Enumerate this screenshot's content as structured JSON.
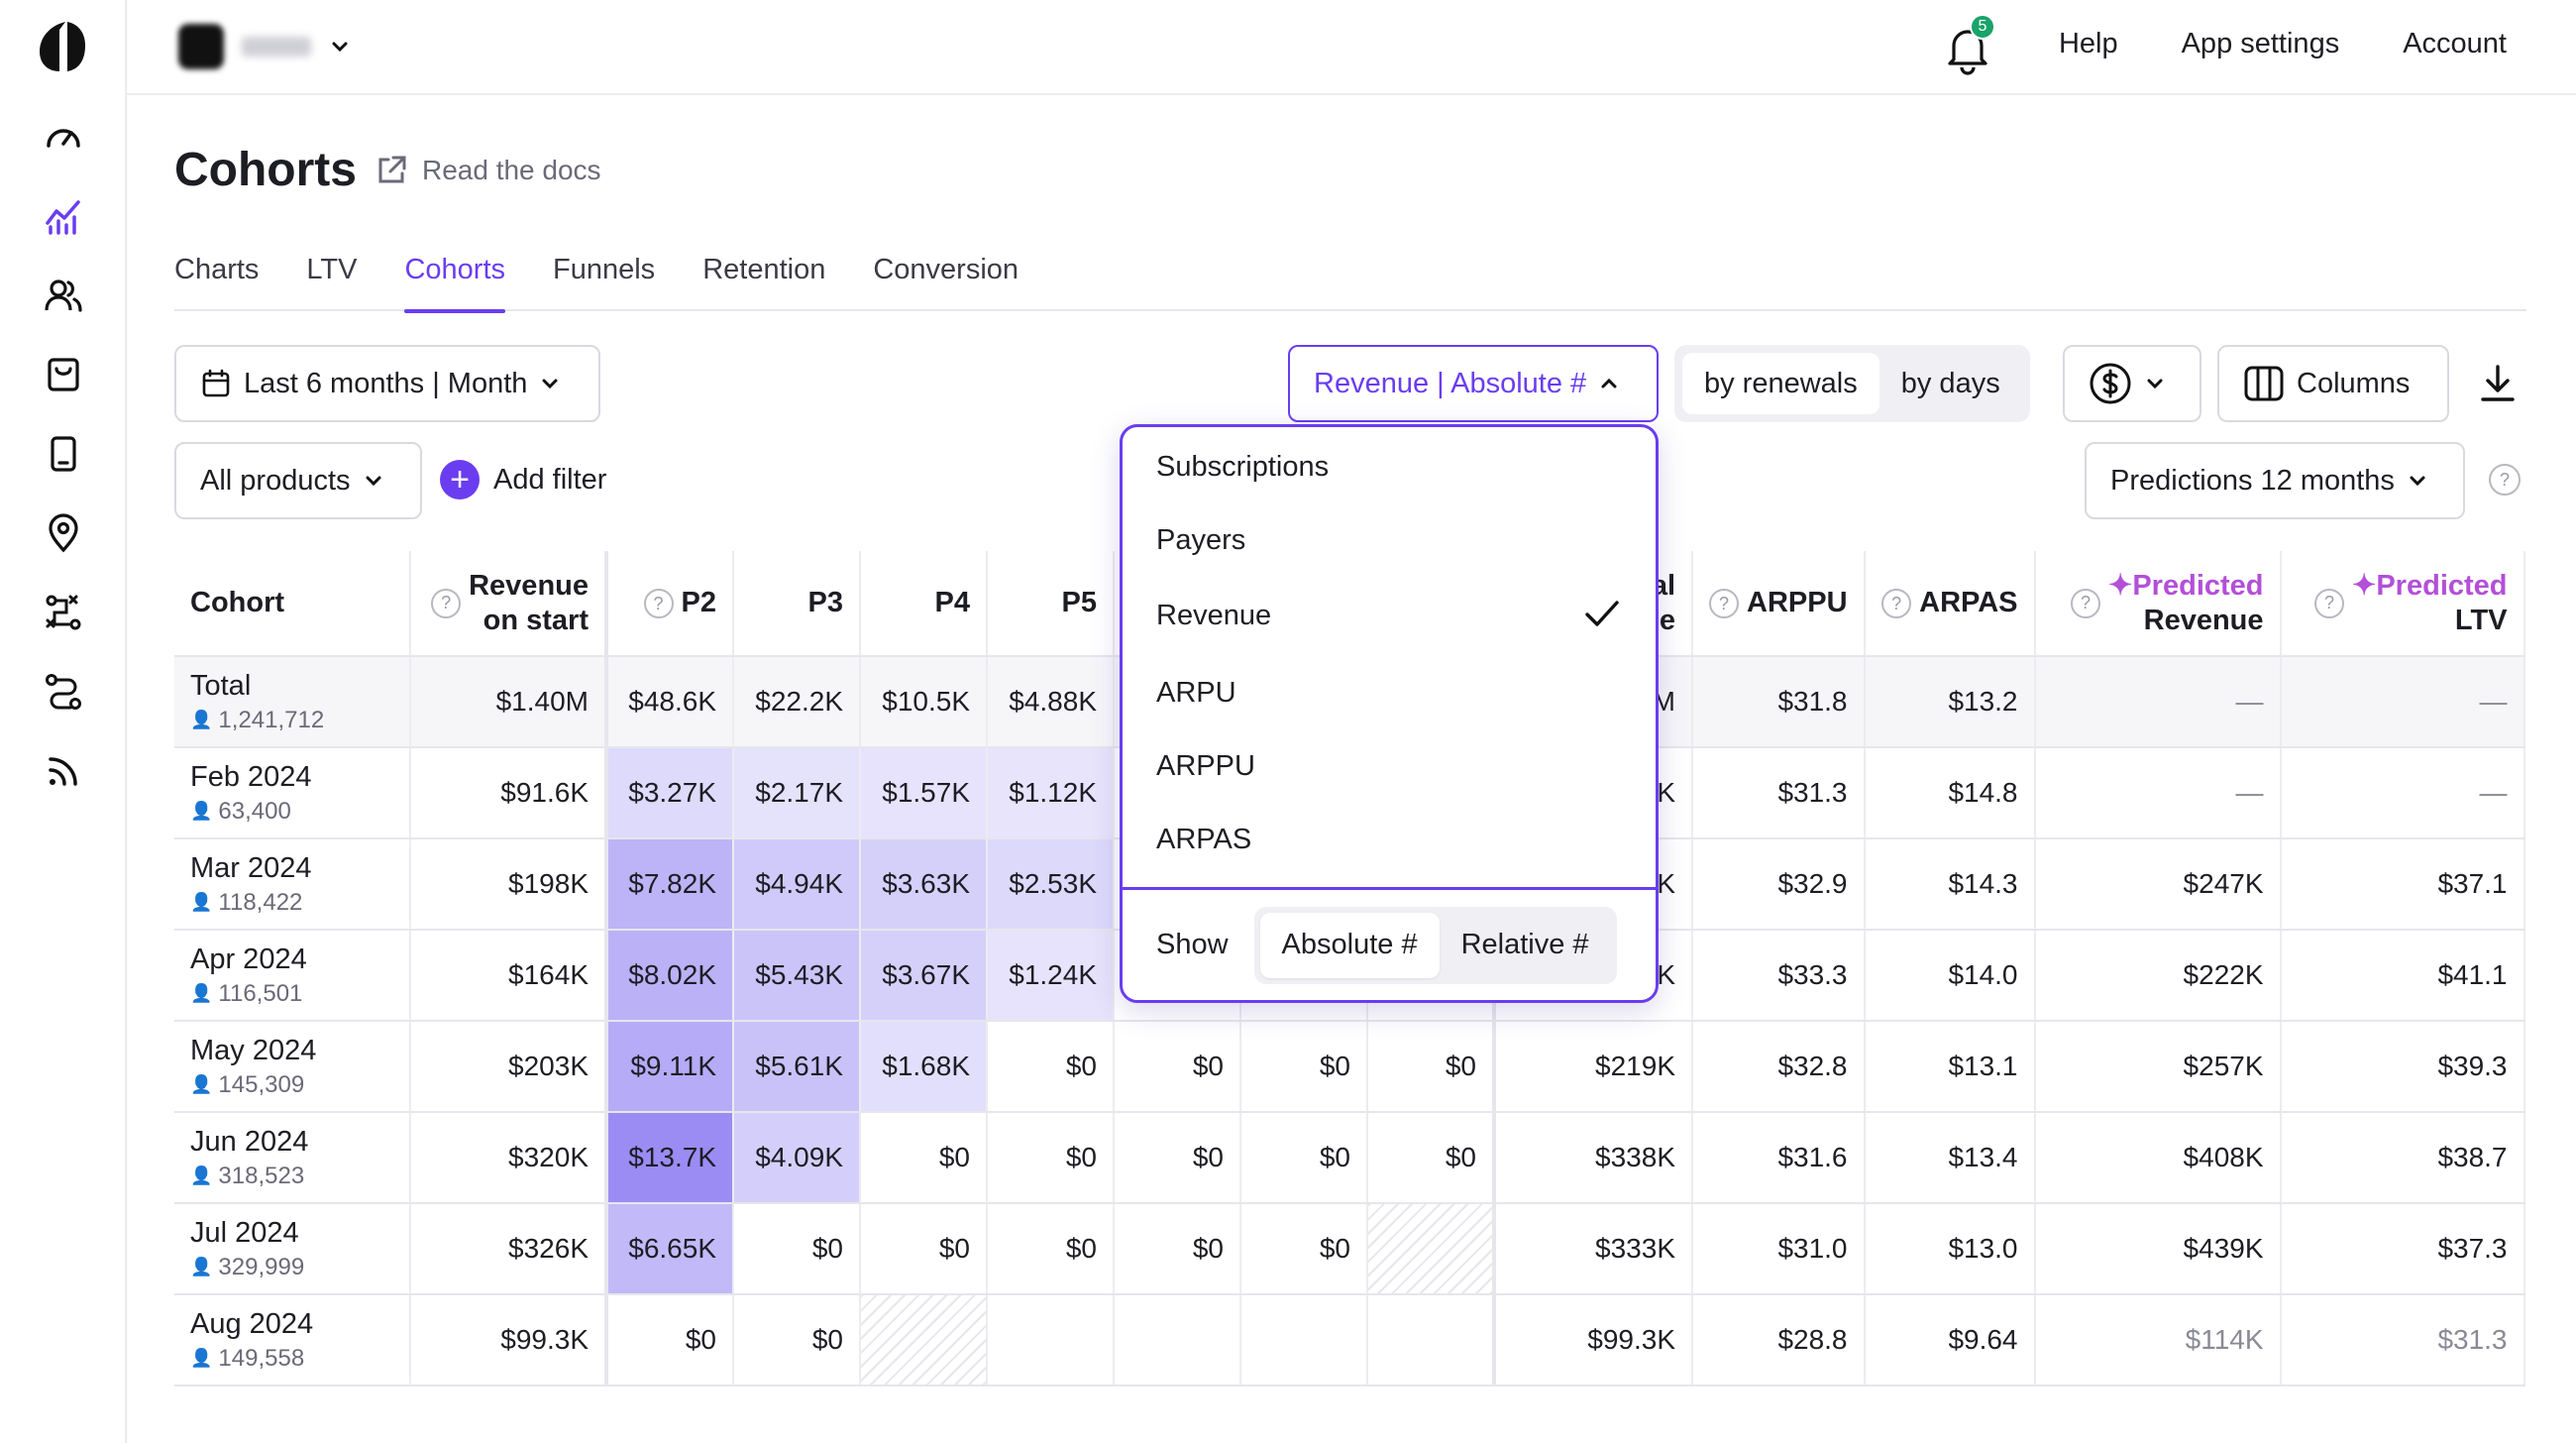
{
  "topbar": {
    "notification_count": "5",
    "help": "Help",
    "app_settings": "App settings",
    "account": "Account"
  },
  "page": {
    "title": "Cohorts",
    "docs_link": "Read the docs"
  },
  "tabs": [
    "Charts",
    "LTV",
    "Cohorts",
    "Funnels",
    "Retention",
    "Conversion"
  ],
  "active_tab": "Cohorts",
  "controls": {
    "date_range": "Last 6 months | Month",
    "metric_select": "Revenue | Absolute #",
    "by_renewals": "by renewals",
    "by_days": "by days",
    "columns": "Columns",
    "products": "All products",
    "add_filter": "Add filter",
    "predictions": "Predictions 12 months"
  },
  "dropdown": {
    "items": [
      "Subscriptions",
      "Payers",
      "Revenue",
      "ARPU",
      "ARPPU",
      "ARPAS"
    ],
    "selected": "Revenue",
    "show_label": "Show",
    "absolute": "Absolute #",
    "relative": "Relative #"
  },
  "table": {
    "headers": {
      "cohort": "Cohort",
      "revenue_on_start_1": "Revenue",
      "revenue_on_start_2": "on start",
      "p2": "P2",
      "p3": "P3",
      "p4": "P4",
      "p5": "P5",
      "total_rev_1": "al",
      "total_rev_2": "e",
      "arppu": "ARPPU",
      "arpas": "ARPAS",
      "pred_rev_1": "Predicted",
      "pred_rev_2": "Revenue",
      "pred_ltv_1": "Predicted",
      "pred_ltv_2": "LTV"
    },
    "rows": [
      {
        "name": "Total",
        "count": "1,241,712",
        "start": "$1.40M",
        "p2": "$48.6K",
        "p3": "$22.2K",
        "p4": "$10.5K",
        "p5": "$4.88K",
        "p6": "",
        "p7": "",
        "p8": "",
        "total": "M",
        "arppu": "$31.8",
        "arpas": "$13.2",
        "pred_rev": "—",
        "pred_ltv": "—"
      },
      {
        "name": "Feb 2024",
        "count": "63,400",
        "start": "$91.6K",
        "p2": "$3.27K",
        "p3": "$2.17K",
        "p4": "$1.57K",
        "p5": "$1.12K",
        "p6": "",
        "p7": "",
        "p8": "",
        "total": "K",
        "arppu": "$31.3",
        "arpas": "$14.8",
        "pred_rev": "—",
        "pred_ltv": "—"
      },
      {
        "name": "Mar 2024",
        "count": "118,422",
        "start": "$198K",
        "p2": "$7.82K",
        "p3": "$4.94K",
        "p4": "$3.63K",
        "p5": "$2.53K",
        "p6": "",
        "p7": "",
        "p8": "",
        "total": "K",
        "arppu": "$32.9",
        "arpas": "$14.3",
        "pred_rev": "$247K",
        "pred_ltv": "$37.1"
      },
      {
        "name": "Apr 2024",
        "count": "116,501",
        "start": "$164K",
        "p2": "$8.02K",
        "p3": "$5.43K",
        "p4": "$3.67K",
        "p5": "$1.24K",
        "p6": "",
        "p7": "",
        "p8": "",
        "total": "K",
        "arppu": "$33.3",
        "arpas": "$14.0",
        "pred_rev": "$222K",
        "pred_ltv": "$41.1"
      },
      {
        "name": "May 2024",
        "count": "145,309",
        "start": "$203K",
        "p2": "$9.11K",
        "p3": "$5.61K",
        "p4": "$1.68K",
        "p5": "$0",
        "p6": "$0",
        "p7": "$0",
        "p8": "$0",
        "total": "$219K",
        "arppu": "$32.8",
        "arpas": "$13.1",
        "pred_rev": "$257K",
        "pred_ltv": "$39.3"
      },
      {
        "name": "Jun 2024",
        "count": "318,523",
        "start": "$320K",
        "p2": "$13.7K",
        "p3": "$4.09K",
        "p4": "$0",
        "p5": "$0",
        "p6": "$0",
        "p7": "$0",
        "p8": "$0",
        "total": "$338K",
        "arppu": "$31.6",
        "arpas": "$13.4",
        "pred_rev": "$408K",
        "pred_ltv": "$38.7"
      },
      {
        "name": "Jul 2024",
        "count": "329,999",
        "start": "$326K",
        "p2": "$6.65K",
        "p3": "$0",
        "p4": "$0",
        "p5": "$0",
        "p6": "$0",
        "p7": "$0",
        "p8": "",
        "total": "$333K",
        "arppu": "$31.0",
        "arpas": "$13.0",
        "pred_rev": "$439K",
        "pred_ltv": "$37.3"
      },
      {
        "name": "Aug 2024",
        "count": "149,558",
        "start": "$99.3K",
        "p2": "$0",
        "p3": "$0",
        "p4": "",
        "p5": "",
        "p6": "",
        "p7": "",
        "p8": "",
        "total": "$99.3K",
        "arppu": "$28.8",
        "arpas": "$9.64",
        "pred_rev": "$114K",
        "pred_ltv": "$31.3"
      }
    ],
    "heat": [
      [
        0,
        0,
        0,
        0
      ],
      [
        0.18,
        0.12,
        0.1,
        0.08
      ],
      [
        0.55,
        0.35,
        0.28,
        0.2
      ],
      [
        0.58,
        0.4,
        0.28,
        0.1
      ],
      [
        0.65,
        0.42,
        0.14,
        0
      ],
      [
        0.95,
        0.3,
        0,
        0
      ],
      [
        0.5,
        0,
        0,
        0
      ],
      [
        0,
        0,
        0,
        0
      ]
    ]
  },
  "colors": {
    "accent": "#6a3df0",
    "predicted": "#b34fd8",
    "heat_base": "#7d6cf0"
  }
}
